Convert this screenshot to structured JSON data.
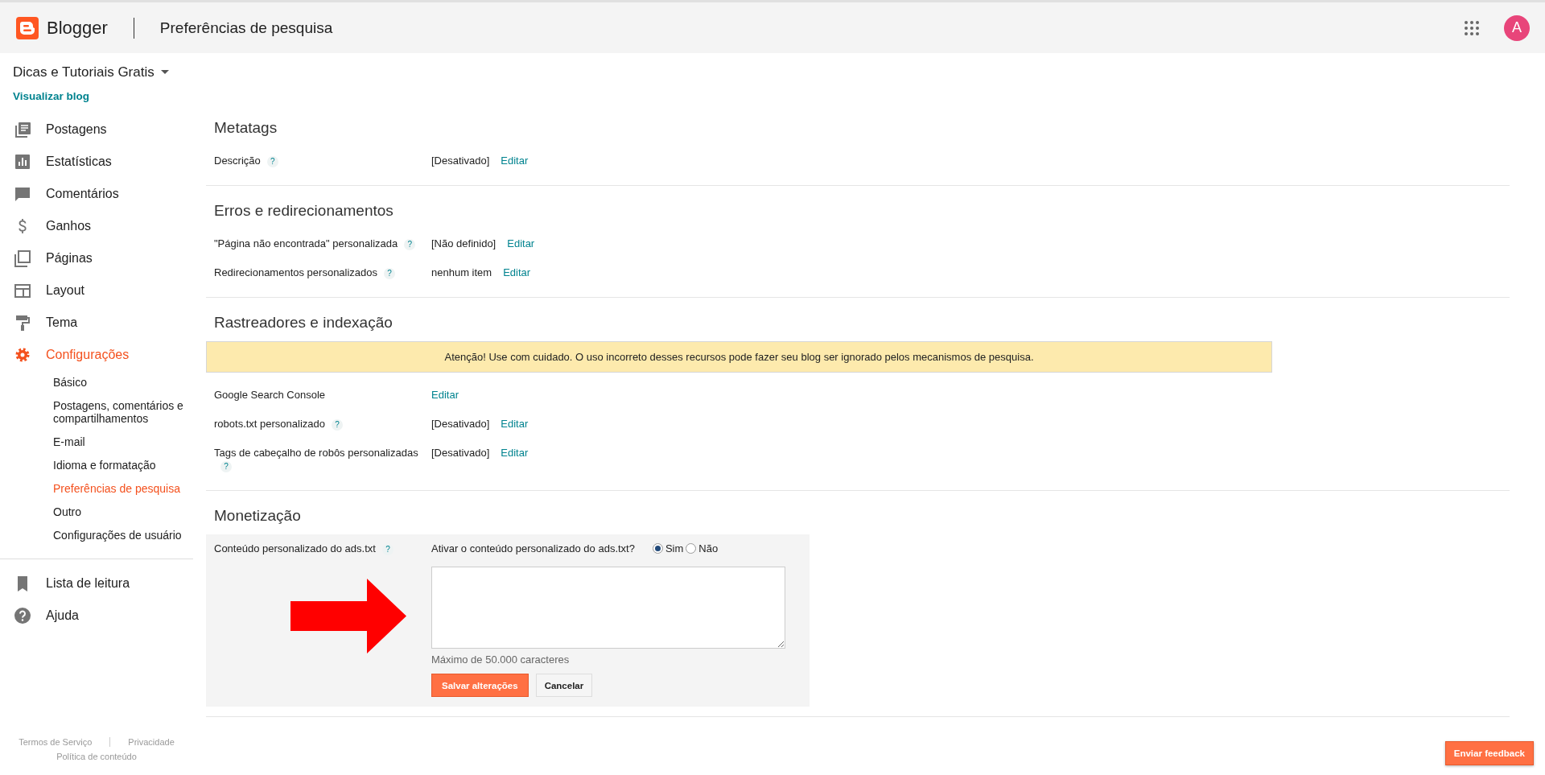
{
  "header": {
    "logo_text": "Blogger",
    "page_title": "Preferências de pesquisa",
    "avatar": "A"
  },
  "sidebar": {
    "blog_name": "Dicas e Tutoriais Gratis",
    "view_blog": "Visualizar blog",
    "items": [
      {
        "label": "Postagens",
        "selected": false
      },
      {
        "label": "Estatísticas",
        "selected": false
      },
      {
        "label": "Comentários",
        "selected": false
      },
      {
        "label": "Ganhos",
        "selected": false
      },
      {
        "label": "Páginas",
        "selected": false
      },
      {
        "label": "Layout",
        "selected": false
      },
      {
        "label": "Tema",
        "selected": false
      },
      {
        "label": "Configurações",
        "selected": true,
        "children": [
          {
            "label": "Básico",
            "selected": false
          },
          {
            "label": "Postagens, comentários e compartilhamentos",
            "selected": false
          },
          {
            "label": "E-mail",
            "selected": false
          },
          {
            "label": "Idioma e formatação",
            "selected": false
          },
          {
            "label": "Preferências de pesquisa",
            "selected": true
          },
          {
            "label": "Outro",
            "selected": false
          },
          {
            "label": "Configurações de usuário",
            "selected": false
          }
        ]
      }
    ],
    "secondary_items": [
      {
        "label": "Lista de leitura"
      },
      {
        "label": "Ajuda"
      }
    ],
    "footer_links": [
      "Termos de Serviço",
      "Privacidade",
      "Política de conteúdo"
    ]
  },
  "sections": [
    {
      "title": "Metatags",
      "rows": [
        {
          "label": "Descrição",
          "help": "?",
          "value": "[Desativado]",
          "link": "Editar"
        }
      ]
    },
    {
      "title": "Erros e redirecionamentos",
      "rows": [
        {
          "label": "\"Página não encontrada\" personalizada",
          "help": "?",
          "value": "[Não definido]",
          "link": "Editar"
        },
        {
          "label": "Redirecionamentos personalizados",
          "help": "?",
          "value": "nenhum item",
          "link": "Editar"
        }
      ]
    },
    {
      "title": "Rastreadores e indexação",
      "warning": "Atenção! Use com cuidado. O uso incorreto desses recursos pode fazer seu blog ser ignorado pelos mecanismos de pesquisa.",
      "rows": [
        {
          "label": "Google Search Console",
          "link": "Editar"
        },
        {
          "label": "robots.txt personalizado",
          "help": "?",
          "value": "[Desativado]",
          "link": "Editar"
        },
        {
          "label": "Tags de cabeçalho de robôs personalizadas",
          "help": "?",
          "value": "[Desativado]",
          "link": "Editar"
        }
      ]
    },
    {
      "title": "Monetização",
      "editor": {
        "label": "Conteúdo personalizado do ads.txt",
        "help": "?",
        "question": "Ativar o conteúdo personalizado do ads.txt?",
        "options": [
          {
            "label": "Sim",
            "selected": true
          },
          {
            "label": "Não",
            "selected": false
          }
        ],
        "hint": "Máximo de 50.000 caracteres",
        "save": "Salvar alterações",
        "cancel": "Cancelar"
      }
    }
  ],
  "feedback_button": "Enviar feedback"
}
